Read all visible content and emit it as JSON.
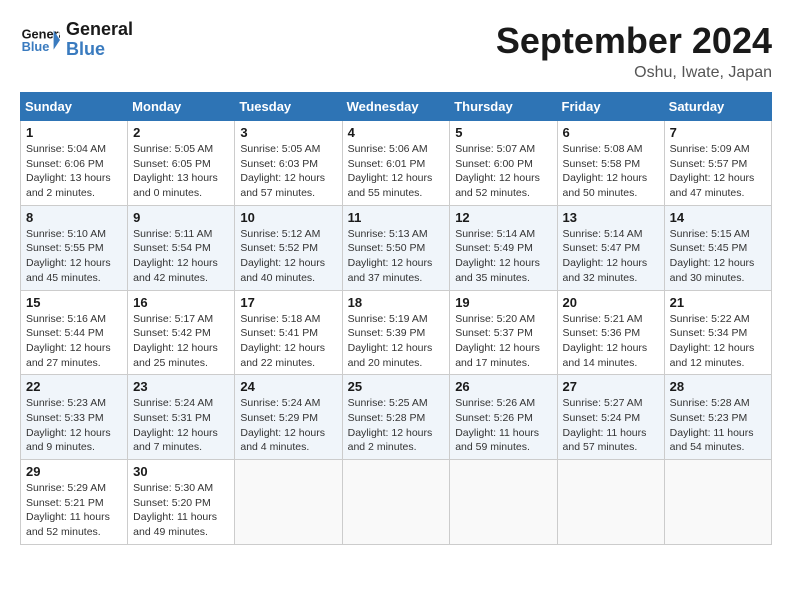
{
  "logo": {
    "text_general": "General",
    "text_blue": "Blue"
  },
  "title": "September 2024",
  "location": "Oshu, Iwate, Japan",
  "days_of_week": [
    "Sunday",
    "Monday",
    "Tuesday",
    "Wednesday",
    "Thursday",
    "Friday",
    "Saturday"
  ],
  "weeks": [
    [
      {
        "day": "1",
        "sunrise": "Sunrise: 5:04 AM",
        "sunset": "Sunset: 6:06 PM",
        "daylight": "Daylight: 13 hours and 2 minutes."
      },
      {
        "day": "2",
        "sunrise": "Sunrise: 5:05 AM",
        "sunset": "Sunset: 6:05 PM",
        "daylight": "Daylight: 13 hours and 0 minutes."
      },
      {
        "day": "3",
        "sunrise": "Sunrise: 5:05 AM",
        "sunset": "Sunset: 6:03 PM",
        "daylight": "Daylight: 12 hours and 57 minutes."
      },
      {
        "day": "4",
        "sunrise": "Sunrise: 5:06 AM",
        "sunset": "Sunset: 6:01 PM",
        "daylight": "Daylight: 12 hours and 55 minutes."
      },
      {
        "day": "5",
        "sunrise": "Sunrise: 5:07 AM",
        "sunset": "Sunset: 6:00 PM",
        "daylight": "Daylight: 12 hours and 52 minutes."
      },
      {
        "day": "6",
        "sunrise": "Sunrise: 5:08 AM",
        "sunset": "Sunset: 5:58 PM",
        "daylight": "Daylight: 12 hours and 50 minutes."
      },
      {
        "day": "7",
        "sunrise": "Sunrise: 5:09 AM",
        "sunset": "Sunset: 5:57 PM",
        "daylight": "Daylight: 12 hours and 47 minutes."
      }
    ],
    [
      {
        "day": "8",
        "sunrise": "Sunrise: 5:10 AM",
        "sunset": "Sunset: 5:55 PM",
        "daylight": "Daylight: 12 hours and 45 minutes."
      },
      {
        "day": "9",
        "sunrise": "Sunrise: 5:11 AM",
        "sunset": "Sunset: 5:54 PM",
        "daylight": "Daylight: 12 hours and 42 minutes."
      },
      {
        "day": "10",
        "sunrise": "Sunrise: 5:12 AM",
        "sunset": "Sunset: 5:52 PM",
        "daylight": "Daylight: 12 hours and 40 minutes."
      },
      {
        "day": "11",
        "sunrise": "Sunrise: 5:13 AM",
        "sunset": "Sunset: 5:50 PM",
        "daylight": "Daylight: 12 hours and 37 minutes."
      },
      {
        "day": "12",
        "sunrise": "Sunrise: 5:14 AM",
        "sunset": "Sunset: 5:49 PM",
        "daylight": "Daylight: 12 hours and 35 minutes."
      },
      {
        "day": "13",
        "sunrise": "Sunrise: 5:14 AM",
        "sunset": "Sunset: 5:47 PM",
        "daylight": "Daylight: 12 hours and 32 minutes."
      },
      {
        "day": "14",
        "sunrise": "Sunrise: 5:15 AM",
        "sunset": "Sunset: 5:45 PM",
        "daylight": "Daylight: 12 hours and 30 minutes."
      }
    ],
    [
      {
        "day": "15",
        "sunrise": "Sunrise: 5:16 AM",
        "sunset": "Sunset: 5:44 PM",
        "daylight": "Daylight: 12 hours and 27 minutes."
      },
      {
        "day": "16",
        "sunrise": "Sunrise: 5:17 AM",
        "sunset": "Sunset: 5:42 PM",
        "daylight": "Daylight: 12 hours and 25 minutes."
      },
      {
        "day": "17",
        "sunrise": "Sunrise: 5:18 AM",
        "sunset": "Sunset: 5:41 PM",
        "daylight": "Daylight: 12 hours and 22 minutes."
      },
      {
        "day": "18",
        "sunrise": "Sunrise: 5:19 AM",
        "sunset": "Sunset: 5:39 PM",
        "daylight": "Daylight: 12 hours and 20 minutes."
      },
      {
        "day": "19",
        "sunrise": "Sunrise: 5:20 AM",
        "sunset": "Sunset: 5:37 PM",
        "daylight": "Daylight: 12 hours and 17 minutes."
      },
      {
        "day": "20",
        "sunrise": "Sunrise: 5:21 AM",
        "sunset": "Sunset: 5:36 PM",
        "daylight": "Daylight: 12 hours and 14 minutes."
      },
      {
        "day": "21",
        "sunrise": "Sunrise: 5:22 AM",
        "sunset": "Sunset: 5:34 PM",
        "daylight": "Daylight: 12 hours and 12 minutes."
      }
    ],
    [
      {
        "day": "22",
        "sunrise": "Sunrise: 5:23 AM",
        "sunset": "Sunset: 5:33 PM",
        "daylight": "Daylight: 12 hours and 9 minutes."
      },
      {
        "day": "23",
        "sunrise": "Sunrise: 5:24 AM",
        "sunset": "Sunset: 5:31 PM",
        "daylight": "Daylight: 12 hours and 7 minutes."
      },
      {
        "day": "24",
        "sunrise": "Sunrise: 5:24 AM",
        "sunset": "Sunset: 5:29 PM",
        "daylight": "Daylight: 12 hours and 4 minutes."
      },
      {
        "day": "25",
        "sunrise": "Sunrise: 5:25 AM",
        "sunset": "Sunset: 5:28 PM",
        "daylight": "Daylight: 12 hours and 2 minutes."
      },
      {
        "day": "26",
        "sunrise": "Sunrise: 5:26 AM",
        "sunset": "Sunset: 5:26 PM",
        "daylight": "Daylight: 11 hours and 59 minutes."
      },
      {
        "day": "27",
        "sunrise": "Sunrise: 5:27 AM",
        "sunset": "Sunset: 5:24 PM",
        "daylight": "Daylight: 11 hours and 57 minutes."
      },
      {
        "day": "28",
        "sunrise": "Sunrise: 5:28 AM",
        "sunset": "Sunset: 5:23 PM",
        "daylight": "Daylight: 11 hours and 54 minutes."
      }
    ],
    [
      {
        "day": "29",
        "sunrise": "Sunrise: 5:29 AM",
        "sunset": "Sunset: 5:21 PM",
        "daylight": "Daylight: 11 hours and 52 minutes."
      },
      {
        "day": "30",
        "sunrise": "Sunrise: 5:30 AM",
        "sunset": "Sunset: 5:20 PM",
        "daylight": "Daylight: 11 hours and 49 minutes."
      },
      null,
      null,
      null,
      null,
      null
    ]
  ]
}
